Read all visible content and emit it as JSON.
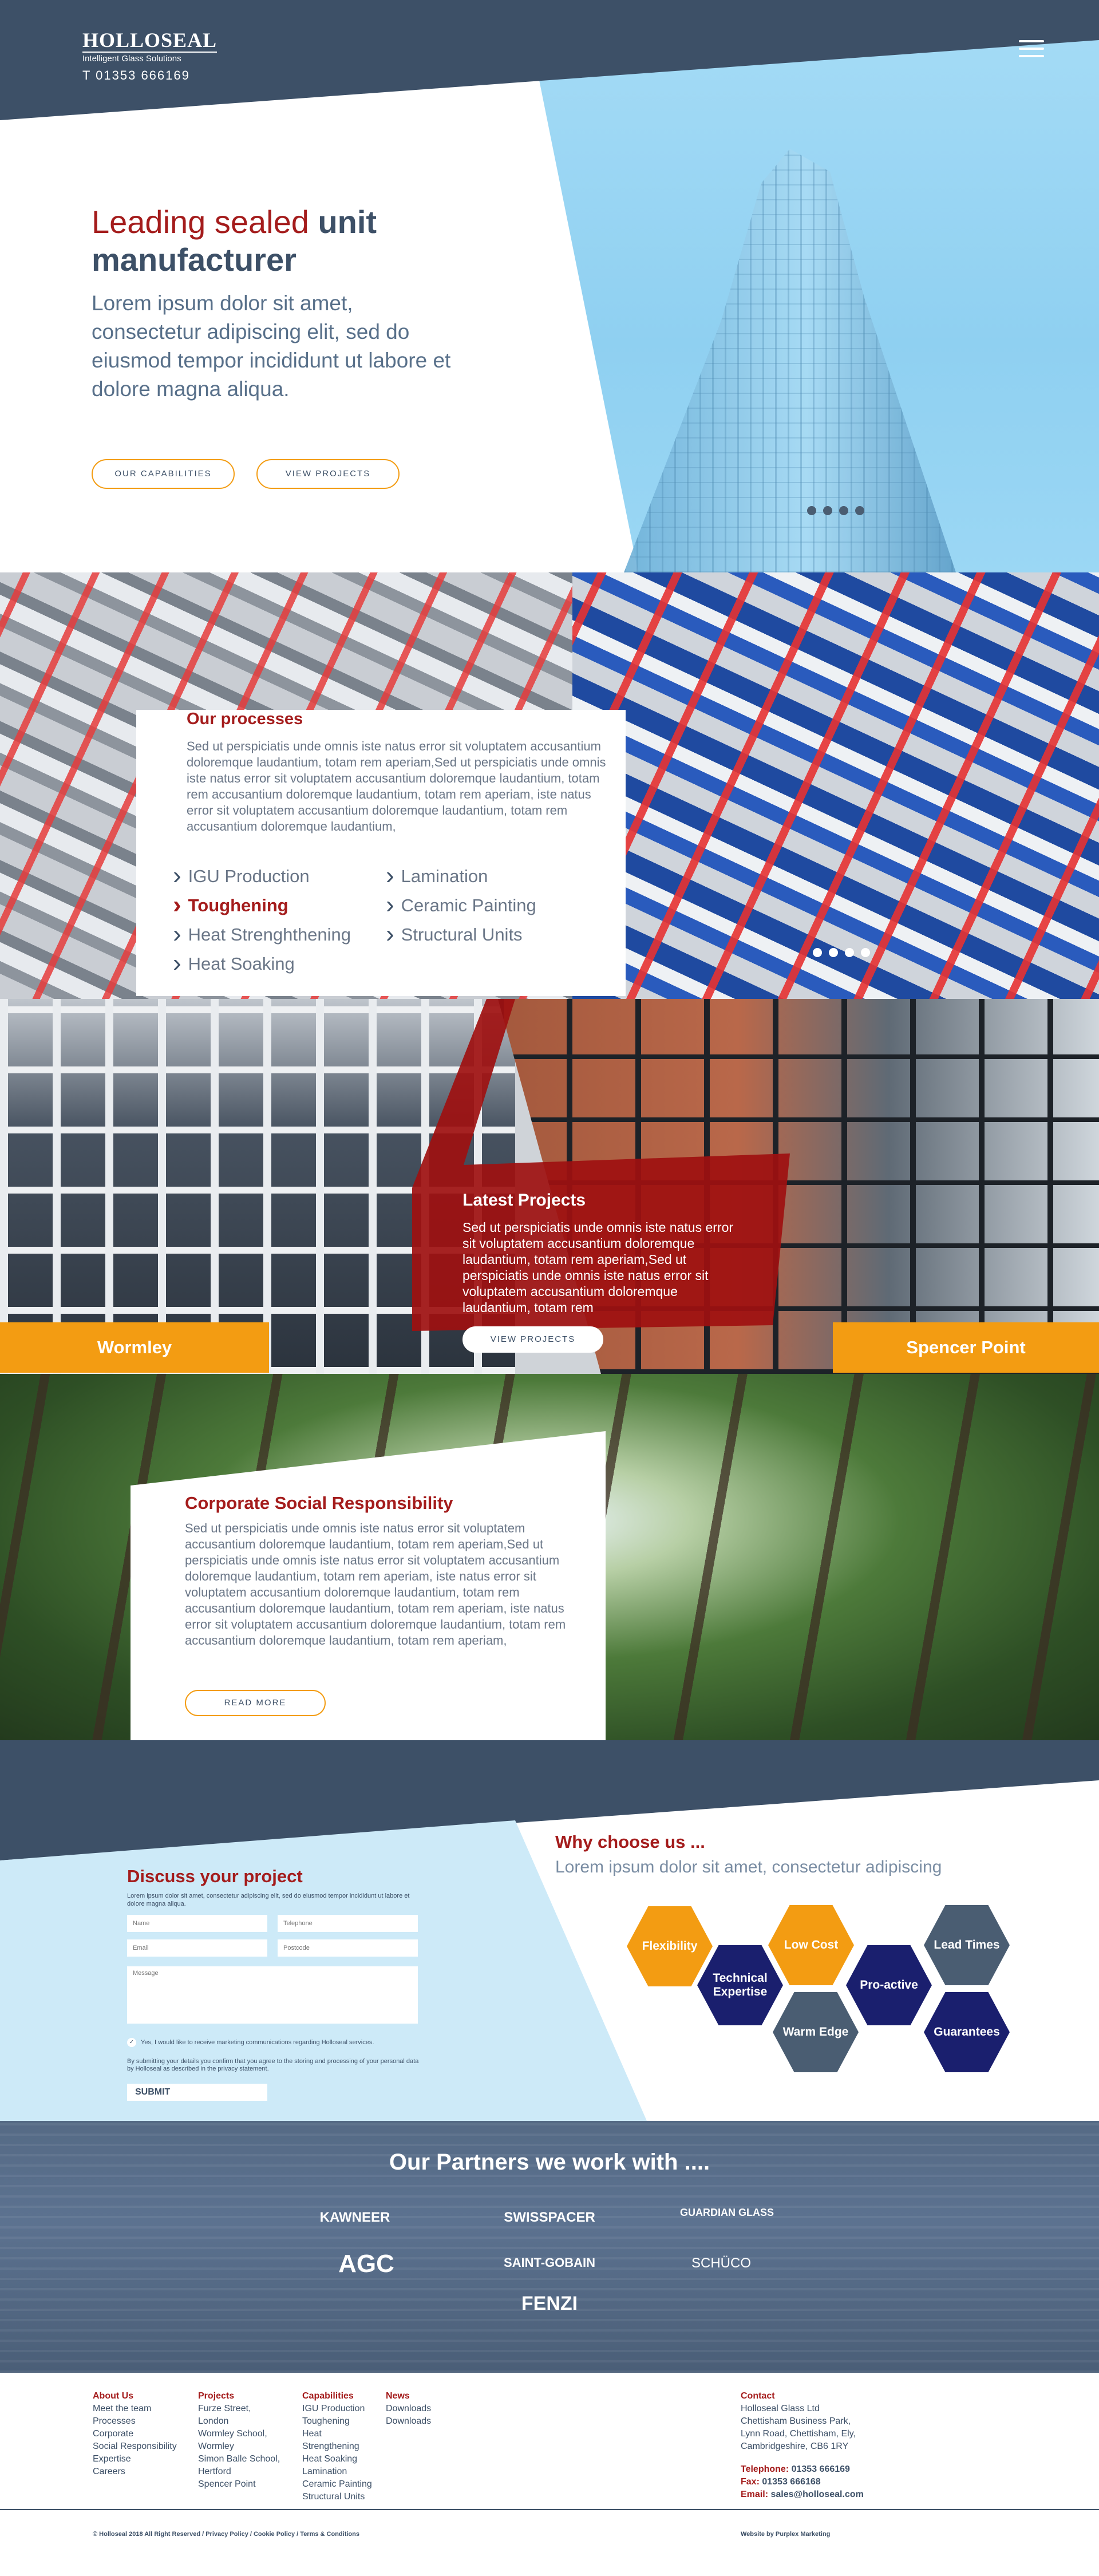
{
  "header": {
    "brand": "HOLLOSEAL",
    "tagline": "Intelligent Glass Solutions",
    "phone": "T 01353 666169"
  },
  "hero": {
    "title_accent": "Leading sealed",
    "title_rest": "unit manufacturer",
    "subtitle": "Lorem ipsum dolor sit amet, consectetur adipiscing elit, sed do eiusmod tempor incididunt ut labore et dolore magna aliqua.",
    "btn_capabilities": "OUR CAPABILITIES",
    "btn_projects": "VIEW PROJECTS"
  },
  "processes": {
    "title": "Our processes",
    "body": "Sed ut perspiciatis unde omnis iste natus error sit voluptatem accusantium doloremque laudantium, totam rem aperiam,Sed ut perspiciatis unde omnis iste natus error sit voluptatem accusantium doloremque laudantium, totam rem accusantium doloremque laudantium, totam rem aperiam, iste natus error sit voluptatem accusantium doloremque laudantium, totam rem accusantium doloremque laudantium,",
    "col1": [
      "IGU Production",
      "Toughening",
      "Heat Strenghthening",
      "Heat Soaking"
    ],
    "col2": [
      "Lamination",
      "Ceramic Painting",
      "Structural Units"
    ]
  },
  "projects": {
    "title": "Latest Projects",
    "body": "Sed ut perspiciatis unde omnis iste natus error sit voluptatem accusantium doloremque laudantium, totam rem aperiam,Sed ut perspiciatis unde omnis iste natus error sit voluptatem accusantium doloremque laudantium, totam rem",
    "button": "VIEW PROJECTS",
    "left_tag": "Wormley",
    "right_tag": "Spencer Point"
  },
  "csr": {
    "title": "Corporate Social Responsibility",
    "body": "Sed ut perspiciatis unde omnis iste natus error sit voluptatem accusantium doloremque laudantium, totam rem aperiam,Sed ut perspiciatis unde omnis iste natus error sit voluptatem accusantium doloremque laudantium, totam rem aperiam, iste natus error sit voluptatem accusantium doloremque laudantium, totam rem accusantium doloremque laudantium, totam rem aperiam, iste natus error sit voluptatem accusantium doloremque laudantium, totam rem accusantium doloremque laudantium, totam rem aperiam,",
    "button": "READ MORE"
  },
  "discuss": {
    "title_a": "Discuss your",
    "title_b": "project",
    "intro": "Lorem ipsum dolor sit amet, consectetur adipiscing elit, sed do eiusmod tempor incididunt ut labore et dolore magna aliqua.",
    "name_ph": "Name",
    "telephone_ph": "Telephone",
    "email_ph": "Email",
    "postcode_ph": "Postcode",
    "message_ph": "Message",
    "consent": "Yes, I would like to receive marketing communications regarding Holloseal services.",
    "privacy": "By submitting your details you confirm that you agree to the storing and processing of your personal data by Holloseal as described in the privacy statement.",
    "submit": "SUBMIT"
  },
  "why": {
    "title": "Why choose us ...",
    "subtitle": "Lorem ipsum dolor sit amet, consectetur adipiscing",
    "hexes": [
      "Flexibility",
      "Technical Expertise",
      "Low Cost",
      "Warm Edge",
      "Pro-active",
      "Lead Times",
      "Guarantees"
    ]
  },
  "partners": {
    "title": "Our Partners we work with ....",
    "logos": [
      "KAWNEER",
      "SWISSPACER",
      "GUARDIAN GLASS",
      "AGC",
      "SAINT-GOBAIN",
      "SCHÜCO",
      "FENZI"
    ]
  },
  "footer": {
    "about": {
      "title": "About Us",
      "links": [
        "Meet the team",
        "Processes",
        "Corporate",
        "Social Responsibility",
        "Expertise",
        "Careers"
      ]
    },
    "projects": {
      "title": "Projects",
      "links": [
        "Furze Street,",
        "London",
        "Wormley School,",
        "Wormley",
        "Simon Balle School,",
        "Hertford",
        "Spencer Point"
      ]
    },
    "capabilities": {
      "title": "Capabilities",
      "links": [
        "IGU Production",
        "Toughening",
        "Heat",
        "Strengthening",
        "Heat Soaking",
        "Lamination",
        "Ceramic Painting",
        "Structural Units"
      ]
    },
    "news": {
      "title": "News",
      "links": [
        "Downloads",
        "Downloads"
      ]
    },
    "contact": {
      "title": "Contact",
      "address": [
        "Holloseal Glass Ltd",
        "Chettisham Business Park,",
        "Lynn Road, Chettisham, Ely,",
        "Cambridgeshire, CB6 1RY"
      ],
      "tel_label": "Telephone:",
      "tel": "01353 666169",
      "fax_label": "Fax:",
      "fax": "01353 666168",
      "email_label": "Email:",
      "email": "sales@holloseal.com"
    },
    "legal": "© Holloseal 2018 All Right Reserved / Privacy Policy / Cookie Policy / Terms & Conditions",
    "credit": "Website by Purplex Marketing"
  },
  "colors": {
    "navy": "#3d5067",
    "red": "#a41c1c",
    "orange": "#f39c12",
    "sky": "#9bd7f4",
    "hex_navy": "#1a1f6e",
    "hex_slate": "#4a5d72"
  }
}
